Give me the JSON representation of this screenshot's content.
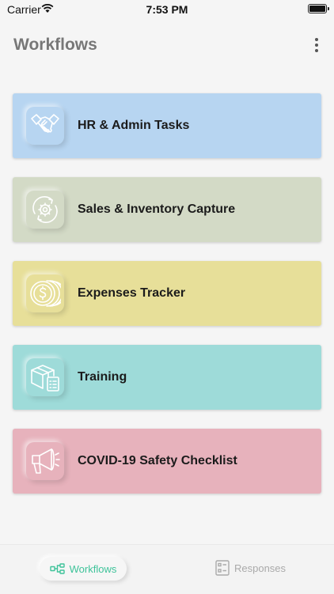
{
  "status_bar": {
    "carrier": "Carrier",
    "time": "7:53 PM"
  },
  "header": {
    "title": "Workflows",
    "menu_icon": "more-vertical-icon"
  },
  "workflows": [
    {
      "label": "HR & Admin Tasks",
      "icon": "handshake-icon",
      "color": "#b7d5f1"
    },
    {
      "label": "Sales & Inventory Capture",
      "icon": "gear-cycle-icon",
      "color": "#d3dac6"
    },
    {
      "label": "Expenses Tracker",
      "icon": "coins-icon",
      "color": "#e7df99"
    },
    {
      "label": "Training",
      "icon": "box-checklist-icon",
      "color": "#9edbd9"
    },
    {
      "label": "COVID-19 Safety Checklist",
      "icon": "megaphone-icon",
      "color": "#e7b2bc"
    }
  ],
  "tab_bar": {
    "tabs": [
      {
        "label": "Workflows",
        "icon": "workflow-icon",
        "active": true
      },
      {
        "label": "Responses",
        "icon": "responses-list-icon",
        "active": false
      }
    ],
    "active_color": "#3fc39a",
    "inactive_color": "#aaaaaa"
  }
}
